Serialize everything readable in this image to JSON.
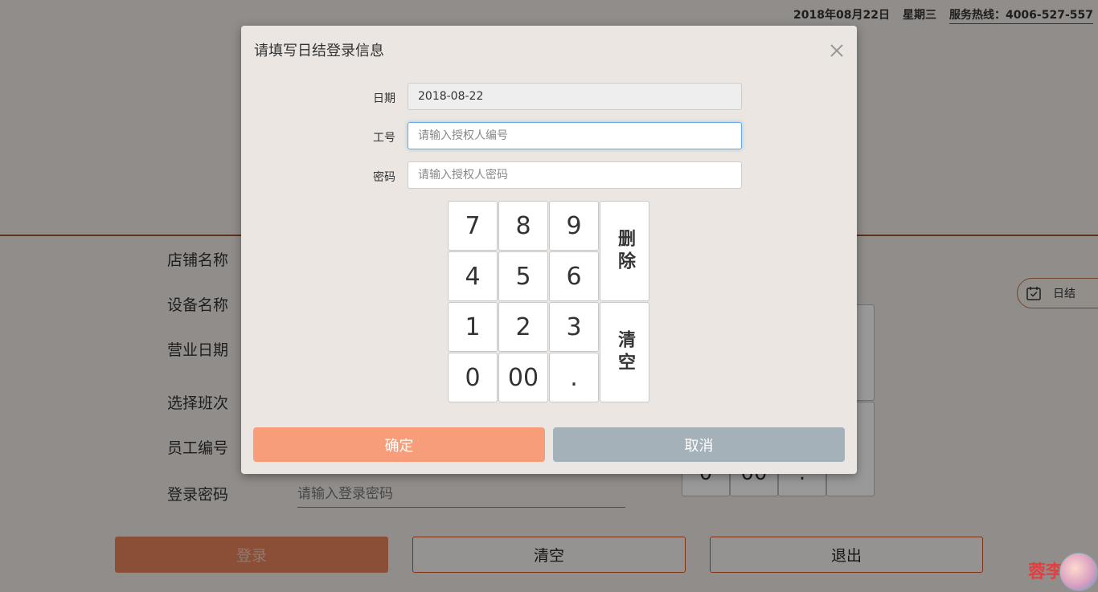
{
  "header": {
    "date": "2018年08月22日",
    "weekday": "星期三",
    "hotline": "服务热线：4006-527-557"
  },
  "form": {
    "store_label": "店铺名称",
    "device_label": "设备名称",
    "business_date_label": "营业日期",
    "shift_label": "选择班次",
    "employee_label": "员工编号",
    "password_label": "登录密码",
    "password_placeholder": "请输入登录密码"
  },
  "rizhi_button": {
    "label": "日结",
    "icon": "calendar-icon"
  },
  "background_keypad": {
    "row_labels": [
      "0",
      "00",
      "."
    ]
  },
  "bottom_buttons": {
    "login": "登录",
    "clear": "清空",
    "exit": "退出"
  },
  "dialog": {
    "title": "请填写日结登录信息",
    "close_icon": "close-icon",
    "date_label": "日期",
    "date_value": "2018-08-22",
    "employee_label": "工号",
    "employee_placeholder": "请输入授权人编号",
    "password_label": "密码",
    "password_placeholder": "请输入授权人密码",
    "keypad": {
      "keys": [
        "7",
        "8",
        "9",
        "4",
        "5",
        "6",
        "1",
        "2",
        "3",
        "0",
        "00",
        "."
      ],
      "delete_label": "删除",
      "clear_label": "清空"
    },
    "confirm_label": "确定",
    "cancel_label": "取消"
  },
  "watermark": "蓉李印"
}
